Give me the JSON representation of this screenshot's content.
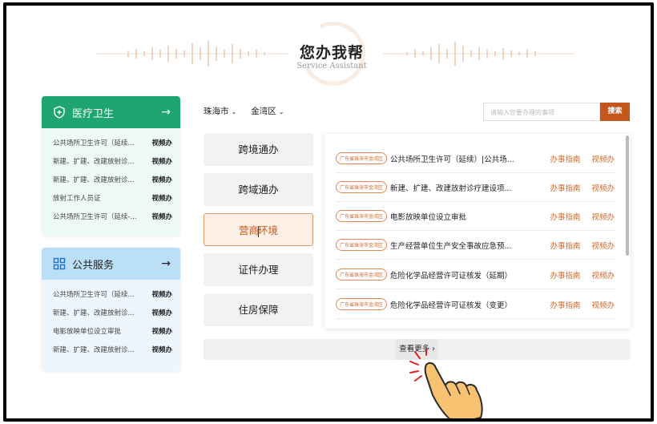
{
  "header": {
    "title": "您办我帮",
    "subtitle": "Service Assistant"
  },
  "colors": {
    "green": "#1fa572",
    "blue_light": "#bcdff8",
    "accent": "#c4561c",
    "badge_orange": "#d06a2c"
  },
  "medical_card": {
    "icon": "shield-plus-icon",
    "title": "医疗卫生",
    "arrow": "→",
    "items": [
      {
        "name": "公共场所卫生许可（延续...",
        "tag": "视频办"
      },
      {
        "name": "新建、扩建、改建放射诊...",
        "tag": "视频办"
      },
      {
        "name": "新建、扩建、改建放射诊...",
        "tag": "视频办"
      },
      {
        "name": "放射工作人员证",
        "tag": "视频办"
      },
      {
        "name": "公共场所卫生许可（延续-...",
        "tag": "视频办"
      }
    ]
  },
  "public_card": {
    "icon": "grid-icon",
    "title": "公共服务",
    "arrow": "→",
    "items": [
      {
        "name": "公共场所卫生许可（延续...",
        "tag": "视频办"
      },
      {
        "name": "新建、扩建、改建放射诊...",
        "tag": "视频办"
      },
      {
        "name": "电影放映单位设立审批",
        "tag": "视频办"
      },
      {
        "name": "新建、扩建、改建放射诊...",
        "tag": "视频办"
      }
    ]
  },
  "filters": {
    "city": "珠海市",
    "district": "金湾区",
    "search_placeholder": "请输入您要办理的事项",
    "search_button": "搜索"
  },
  "tabs": [
    {
      "label": "跨境通办",
      "active": false
    },
    {
      "label": "跨域通办",
      "active": false
    },
    {
      "label_before": "营商",
      "label_after": "环境",
      "active": true
    },
    {
      "label": "证件办理",
      "active": false
    },
    {
      "label": "住房保障",
      "active": false
    }
  ],
  "list": [
    {
      "badge": "广东省珠海市金湾区",
      "title": "公共场所卫生许可（延续）|公共场...",
      "guide": "办事指南",
      "video": "视频办"
    },
    {
      "badge": "广东省珠海市金湾区",
      "title": "新建、扩建、改建放射诊疗建设项...",
      "guide": "办事指南",
      "video": "视频办"
    },
    {
      "badge": "广东省珠海市金湾区",
      "title": "电影放映单位设立审批",
      "guide": "办事指南",
      "video": "视频办"
    },
    {
      "badge": "广东省珠海市金湾区",
      "title": "生产经营单位生产安全事故应急预...",
      "guide": "办事指南",
      "video": "视频办"
    },
    {
      "badge": "广东省珠海市金湾区",
      "title": "危险化学品经营许可证核发（延期）",
      "guide": "办事指南",
      "video": "视频办"
    },
    {
      "badge": "广东省珠海市金湾区",
      "title": "危险化学品经营许可证核发（变更）",
      "guide": "办事指南",
      "video": "视频办"
    }
  ],
  "more": {
    "label": "查看更多 ›"
  },
  "overlay": {
    "icon": "pointing-hand-icon"
  }
}
